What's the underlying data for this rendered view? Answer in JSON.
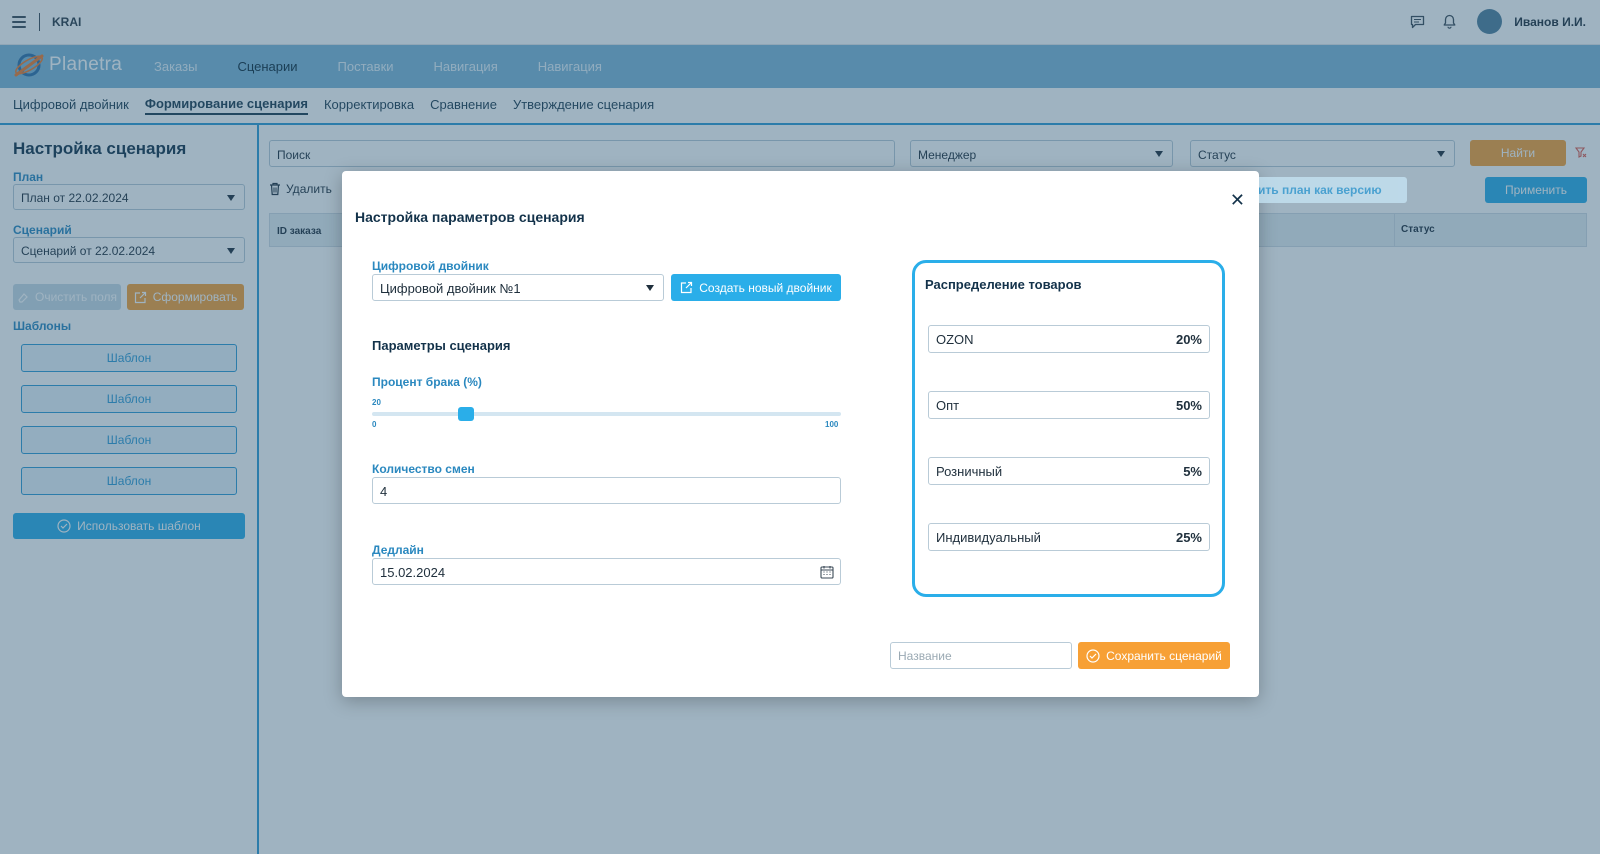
{
  "topbar": {
    "brand": "KRAI",
    "username": "Иванов И.И.",
    "icons": [
      "menu-icon",
      "chat-icon",
      "bell-icon"
    ]
  },
  "navbar": {
    "logo_text": "Planetra",
    "items": [
      {
        "label": "Заказы"
      },
      {
        "label": "Сценарии"
      },
      {
        "label": "Поставки"
      },
      {
        "label": "Навигация"
      },
      {
        "label": "Навигация"
      }
    ]
  },
  "subnav": {
    "items": [
      {
        "label": "Цифровой двойник"
      },
      {
        "label": "Формирование сценария"
      },
      {
        "label": "Корректировка"
      },
      {
        "label": "Сравнение"
      },
      {
        "label": "Утверждение сценария"
      }
    ]
  },
  "sidebar": {
    "title": "Настройка сценария",
    "plan_label": "План",
    "plan_value": "План от 22.02.2024",
    "scenario_label": "Сценарий",
    "scenario_value": "Сценарий от 22.02.2024",
    "clear_button": "Очистить поля",
    "form_button": "Сформировать",
    "templates_label": "Шаблоны",
    "templates": [
      "Шаблон",
      "Шаблон",
      "Шаблон",
      "Шаблон"
    ],
    "use_template_button": "Использовать шаблон"
  },
  "main": {
    "search_placeholder": "Поиск",
    "manager_value": "Менеджер",
    "status_value": "Статус",
    "find_button": "Найти",
    "delete_button": "Удалить",
    "save_version_button": "Сохранить план как версию",
    "apply_button": "Применить",
    "columns": {
      "id": "ID заказа",
      "status": "Статус"
    }
  },
  "modal": {
    "title": "Настройка параметров сценария",
    "twin_label": "Цифровой двойник",
    "twin_value": "Цифровой двойник №1",
    "create_twin_button": "Создать новый двойник",
    "params_title": "Параметры сценария",
    "defect_label": "Процент брака (%)",
    "defect_value": "20",
    "defect_fraction": 0.2,
    "slider_min": "0",
    "slider_max": "100",
    "shifts_label": "Количество смен",
    "shifts_value": "4",
    "deadline_label": "Дедлайн",
    "deadline_value": "15.02.2024",
    "distribution": {
      "title": "Распределение товаров",
      "rows": [
        {
          "name": "OZON",
          "pct": "20%"
        },
        {
          "name": "Опт",
          "pct": "50%"
        },
        {
          "name": "Розничный",
          "pct": "5%"
        },
        {
          "name": "Индивидуальный",
          "pct": "25%"
        }
      ]
    },
    "name_placeholder": "Название",
    "save_button": "Сохранить сценарий"
  },
  "colors": {
    "accent": "#2aaee9",
    "orange": "#f7a035",
    "navbar": "#7fb7d8"
  }
}
